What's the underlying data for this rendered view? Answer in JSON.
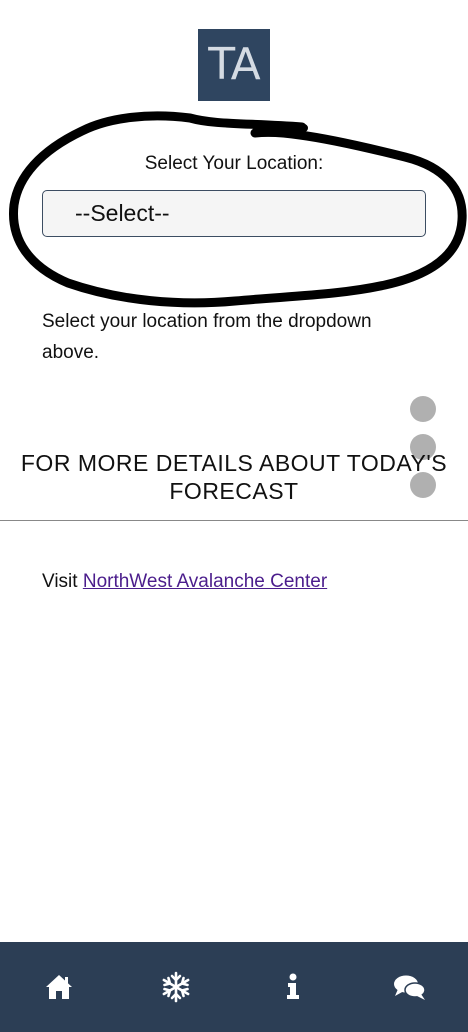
{
  "logo": {
    "text": "TA",
    "bg_color": "#2f4560",
    "text_color": "#d5dbe3"
  },
  "location": {
    "label": "Select Your Location:",
    "selected_option": "--Select--",
    "help_text": "Select your location from the dropdown above."
  },
  "forecast": {
    "heading": "FOR MORE DETAILS ABOUT TODAY'S FORECAST",
    "visit_prefix": "Visit ",
    "link_text": "NorthWest Avalanche Center",
    "link_color": "#4b1d8c"
  },
  "side_menu": {
    "icon": "vertical-dots-icon",
    "color": "#b0b0b0"
  },
  "bottom_nav": {
    "bg_color": "#2c3e55",
    "items": [
      {
        "icon": "home-icon"
      },
      {
        "icon": "snowflake-icon"
      },
      {
        "icon": "info-icon"
      },
      {
        "icon": "chat-icon"
      }
    ]
  }
}
